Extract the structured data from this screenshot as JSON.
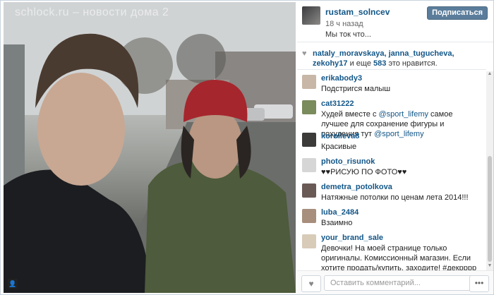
{
  "photo": {
    "watermark": "schlock.ru – новости дома 2",
    "user_tag_icon": "person-icon"
  },
  "post": {
    "username": "rustam_solncev",
    "time": "18 ч назад",
    "caption": "Мы ток что...",
    "follow_label": "Подписаться"
  },
  "likes": {
    "names": "nataly_moravskaya, janna_tugucheva, zekohy17",
    "more": "и еще",
    "count": "583",
    "suffix": "это нравится."
  },
  "comments": [
    {
      "user": "erikabody3",
      "text": "Подстригся малыш",
      "color": "#c8b6a6"
    },
    {
      "user": "cat31222",
      "text": "Худей вместе с @sport_lifemy самое лучшее для сохранение фигуры и похудения тут @sport_lifemy",
      "color": "#7a8b5c"
    },
    {
      "user": "korolleva8",
      "text": "Красивые",
      "color": "#3d3a3a"
    },
    {
      "user": "photo_risunok",
      "text": "♥♥РИСУЮ ПО ФОТО♥♥",
      "color": "#d6d6d6"
    },
    {
      "user": "demetra_potolkova",
      "text": "Натяжные потолки по ценам лета 2014!!!",
      "color": "#6a5a56"
    },
    {
      "user": "luba_2484",
      "text": "Взаимно",
      "color": "#a88e7c"
    },
    {
      "user": "your_brand_sale",
      "text": "Девочки! На моей странице только оригиналы. Комиссионный магазин. Если хотите продать/купить, заходите! #декрррр",
      "color": "#d8cbb8"
    }
  ],
  "footer": {
    "placeholder": "Оставить комментарий...",
    "more_label": "•••"
  },
  "icons": {
    "heart": "heart-icon",
    "scroll_up": "chevron-up-icon",
    "scroll_down": "chevron-down-icon"
  }
}
